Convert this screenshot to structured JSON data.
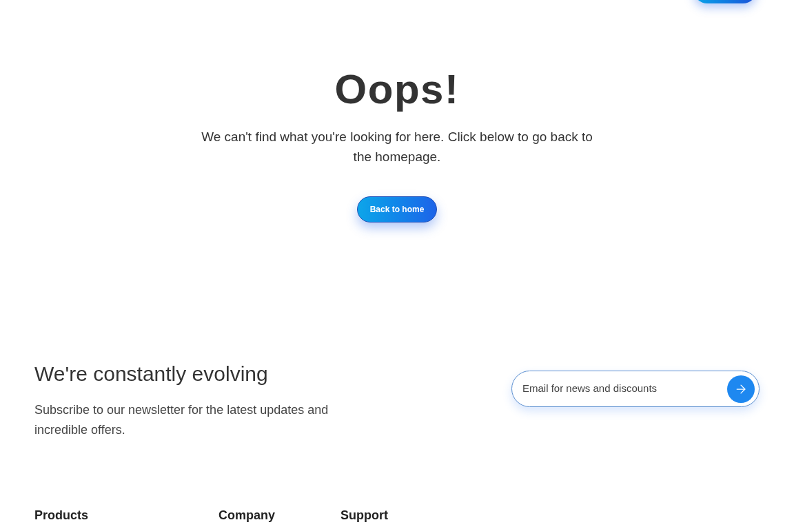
{
  "header": {
    "cta_button": {
      "kind": "cut"
    }
  },
  "error": {
    "title": "Oops!",
    "message": "We can't find what you're looking for here. Click below to go back to the homepage.",
    "button": "Back to home"
  },
  "newsletter": {
    "title": "We're constantly evolving",
    "text": "Subscribe to our newsletter for the latest updates and incredible offers.",
    "email_placeholder": "Email for news and discounts"
  },
  "footer": {
    "columns": [
      {
        "heading": "Products"
      },
      {
        "heading": "Company"
      },
      {
        "heading": "Support"
      }
    ]
  }
}
